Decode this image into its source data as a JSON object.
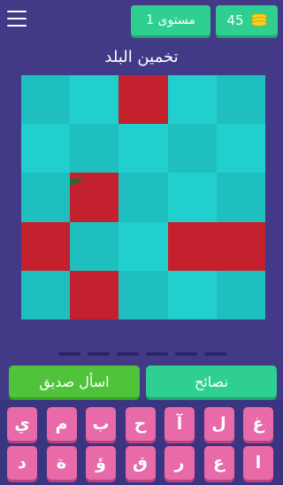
{
  "header": {
    "menu_icon": "hamburger-menu-icon",
    "level_label": "مستوى 1",
    "coins": "45",
    "coin_icon": "coin-stack-icon"
  },
  "title": "تخمين البلد",
  "colors": {
    "background": "#433a87",
    "teal_a": "#1fbfbf",
    "teal_b": "#22cfcf",
    "red": "#c4212e",
    "green_button": "#4fc43a",
    "mint_button": "#2fcf92",
    "key_pink": "#e86aa8"
  },
  "board": {
    "rows": 5,
    "cols": 5,
    "tiles": [
      [
        "teal_a",
        "teal_b",
        "red",
        "teal_b",
        "teal_a"
      ],
      [
        "teal_b",
        "teal_a",
        "teal_b",
        "teal_a",
        "teal_b"
      ],
      [
        "teal_a",
        "red_flag",
        "teal_a",
        "teal_b",
        "teal_a"
      ],
      [
        "red",
        "teal_a",
        "teal_b",
        "red",
        "red"
      ],
      [
        "teal_a",
        "red",
        "teal_a",
        "teal_b",
        "teal_a"
      ]
    ]
  },
  "answer": {
    "slots": 6
  },
  "actions": {
    "ask_friend": "اسأل صديق",
    "tips": "نصائح"
  },
  "keyboard": {
    "row1": [
      "غ",
      "ل",
      "آ",
      "ح",
      "ب",
      "م",
      "ي"
    ],
    "row2": [
      "ا",
      "ع",
      "ر",
      "ق",
      "ؤ",
      "ة",
      "د"
    ]
  }
}
